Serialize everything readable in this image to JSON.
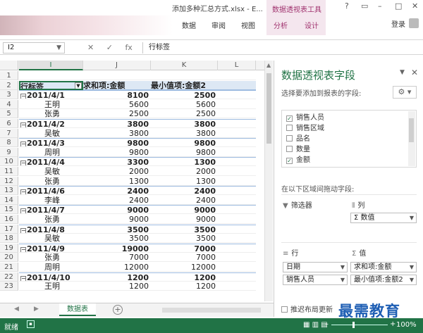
{
  "window": {
    "title": "添加多种汇总方式.xlsx - E...",
    "context_tools": "数据透视表工具",
    "help": "?",
    "restore": "▭",
    "minimize": "–",
    "maximize": "□",
    "close": "✕"
  },
  "ribbon": {
    "tabs": [
      "数据",
      "审阅",
      "视图",
      "分析",
      "设计"
    ],
    "login": "登录"
  },
  "formula_bar": {
    "name_box": "I2",
    "cancel": "✕",
    "enter": "✓",
    "fx": "fx",
    "value": "行标签"
  },
  "grid": {
    "columns": [
      "I",
      "J",
      "K",
      "L"
    ],
    "rows": [
      {
        "n": "1",
        "type": "blank",
        "i": "",
        "j": "",
        "k": ""
      },
      {
        "n": "2",
        "type": "hdr",
        "i": "行标签",
        "j": "求和项:金额",
        "k": "最小值项:金额2"
      },
      {
        "n": "3",
        "type": "grp",
        "i": "2011/4/1",
        "j": "8100",
        "k": "2500"
      },
      {
        "n": "4",
        "type": "det",
        "i": "王明",
        "j": "5600",
        "k": "5600"
      },
      {
        "n": "5",
        "type": "det",
        "i": "张勇",
        "j": "2500",
        "k": "2500"
      },
      {
        "n": "6",
        "type": "grp",
        "i": "2011/4/2",
        "j": "3800",
        "k": "3800"
      },
      {
        "n": "7",
        "type": "det",
        "i": "吴敏",
        "j": "3800",
        "k": "3800"
      },
      {
        "n": "8",
        "type": "grp",
        "i": "2011/4/3",
        "j": "9800",
        "k": "9800"
      },
      {
        "n": "9",
        "type": "det",
        "i": "周明",
        "j": "9800",
        "k": "9800"
      },
      {
        "n": "10",
        "type": "grp",
        "i": "2011/4/4",
        "j": "3300",
        "k": "1300"
      },
      {
        "n": "11",
        "type": "det",
        "i": "吴敏",
        "j": "2000",
        "k": "2000"
      },
      {
        "n": "12",
        "type": "det",
        "i": "张勇",
        "j": "1300",
        "k": "1300"
      },
      {
        "n": "13",
        "type": "grp",
        "i": "2011/4/6",
        "j": "2400",
        "k": "2400"
      },
      {
        "n": "14",
        "type": "det",
        "i": "李峰",
        "j": "2400",
        "k": "2400"
      },
      {
        "n": "15",
        "type": "grp",
        "i": "2011/4/7",
        "j": "9000",
        "k": "9000"
      },
      {
        "n": "16",
        "type": "det",
        "i": "张勇",
        "j": "9000",
        "k": "9000"
      },
      {
        "n": "17",
        "type": "grp",
        "i": "2011/4/8",
        "j": "3500",
        "k": "3500"
      },
      {
        "n": "18",
        "type": "det",
        "i": "吴敏",
        "j": "3500",
        "k": "3500"
      },
      {
        "n": "19",
        "type": "grp",
        "i": "2011/4/9",
        "j": "19000",
        "k": "7000"
      },
      {
        "n": "20",
        "type": "det",
        "i": "张勇",
        "j": "7000",
        "k": "7000"
      },
      {
        "n": "21",
        "type": "det",
        "i": "周明",
        "j": "12000",
        "k": "12000"
      },
      {
        "n": "22",
        "type": "grp",
        "i": "2011/4/10",
        "j": "1200",
        "k": "1200"
      },
      {
        "n": "23",
        "type": "det",
        "i": "王明",
        "j": "1200",
        "k": "1200"
      }
    ],
    "collapse_glyph": "⊟"
  },
  "sheets": {
    "tabs": [
      "数据表"
    ],
    "add": "+",
    "prev": "◀",
    "next": "▶"
  },
  "pivot_pane": {
    "title": "数据透视表字段",
    "subtitle": "选择要添加到报表的字段:",
    "close": "✕",
    "menu": "▼",
    "gear": "⚙ ▾",
    "fields": [
      {
        "label": "销售人员",
        "checked": true
      },
      {
        "label": "销售区域",
        "checked": false
      },
      {
        "label": "品名",
        "checked": false
      },
      {
        "label": "数量",
        "checked": false
      },
      {
        "label": "金额",
        "checked": true
      }
    ],
    "drag_hint": "在以下区域间拖动字段:",
    "areas": {
      "filters": {
        "label": "筛选器",
        "icon": "▼"
      },
      "columns": {
        "label": "列",
        "icon": "⦀",
        "items": [
          "Σ 数值"
        ]
      },
      "rows": {
        "label": "行",
        "icon": "≡",
        "items": [
          "日期",
          "销售人员"
        ]
      },
      "values": {
        "label": "值",
        "icon": "Σ",
        "items": [
          "求和项:金额",
          "最小值项:金额2"
        ]
      }
    },
    "defer": "推迟布局更新"
  },
  "watermark": "最需教育",
  "status": {
    "ready": "就绪",
    "zoom": "100%",
    "zoom_minus": "–",
    "zoom_plus": "+",
    "views": "▦ ▥ ▤"
  },
  "checkmark": "✓",
  "colors": {
    "accent": "#217346",
    "context": "#a0326e",
    "header_fill": "#dde8f4"
  }
}
